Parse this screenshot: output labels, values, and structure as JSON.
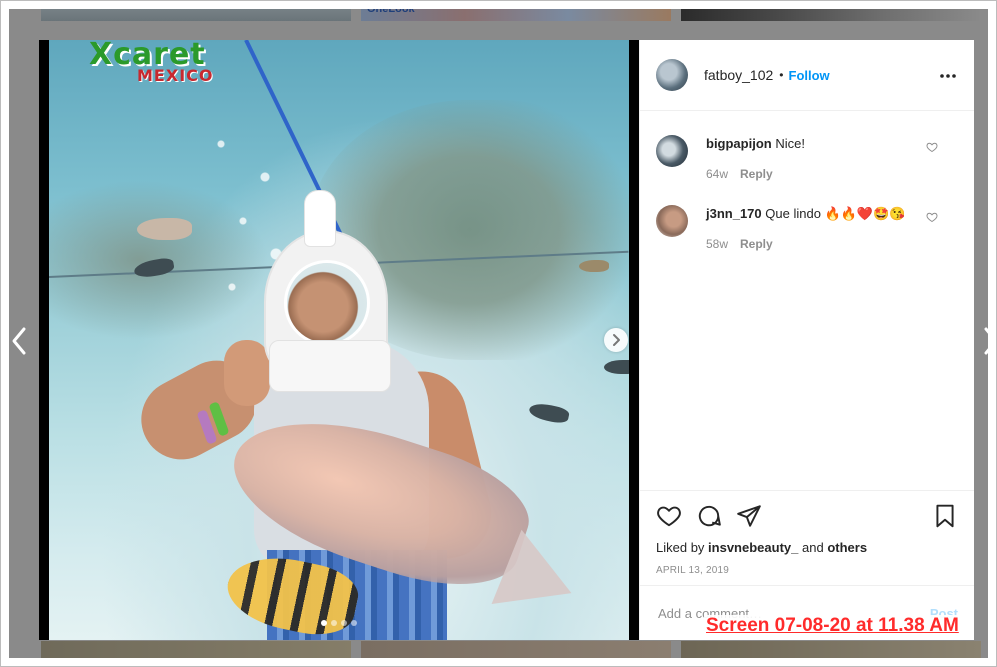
{
  "background": {
    "thumb2_text": "OneLook"
  },
  "post": {
    "username": "fatboy_102",
    "follow_label": "Follow",
    "more_label": "•••",
    "carousel": {
      "slide_count": 4,
      "active_index": 0
    },
    "photo": {
      "logo_main": "Xcaret",
      "logo_sub": "MEXICO"
    },
    "comments": [
      {
        "username": "bigpapijon",
        "text": "Nice!",
        "age": "64w",
        "reply_label": "Reply"
      },
      {
        "username": "j3nn_170",
        "text": "Que lindo 🔥🔥❤️🤩😘",
        "age": "58w",
        "reply_label": "Reply"
      }
    ],
    "likes": {
      "prefix": "Liked by",
      "user": "insvnebeauty_",
      "joiner": "and",
      "others": "others"
    },
    "date": "APRIL 13, 2019",
    "comment_box": {
      "placeholder": "Add a comment…",
      "post_label": "Post"
    }
  },
  "icons": {
    "left_arrow": "chevron-left-icon",
    "right_arrow": "chevron-right-icon",
    "media_next": "chevron-right-icon",
    "like": "heart-icon",
    "comment": "comment-icon",
    "share": "send-icon",
    "save": "bookmark-icon",
    "comment_like": "heart-icon"
  },
  "screen_stamp": "Screen 07-08-20 at 11.38 AM",
  "colors": {
    "follow": "#0095f6",
    "post_disabled": "#b2dffc",
    "stamp": "#ff2b2b"
  }
}
